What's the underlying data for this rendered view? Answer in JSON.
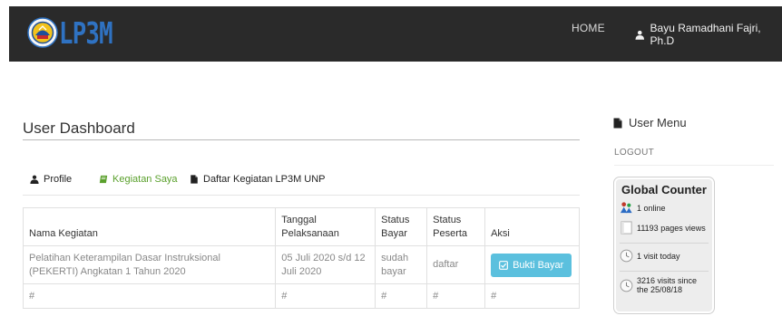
{
  "header": {
    "logo_text": "LP3M",
    "nav_home": "HOME",
    "user_name": "Bayu Ramadhani Fajri, Ph.D"
  },
  "main": {
    "title": "User Dashboard",
    "tabs": [
      {
        "label": "Profile",
        "icon": "user-icon",
        "active": false
      },
      {
        "label": "Kegiatan Saya",
        "icon": "book-icon",
        "active": true
      },
      {
        "label": "Daftar Kegiatan LP3M UNP",
        "icon": "file-icon",
        "active": false
      }
    ],
    "table": {
      "headers": [
        "Nama Kegiatan",
        "Tanggal Pelaksanaan",
        "Status Bayar",
        "Status Peserta",
        "Aksi"
      ],
      "rows": [
        {
          "nama": "Pelatihan Keterampilan Dasar Instruksional (PEKERTI) Angkatan 1 Tahun 2020",
          "tanggal": "05 Juli 2020 s/d 12 Juli 2020",
          "status_bayar": "sudah bayar",
          "status_peserta": "daftar",
          "aksi": "Bukti Bayar"
        },
        {
          "nama": "#",
          "tanggal": "#",
          "status_bayar": "#",
          "status_peserta": "#",
          "aksi": "#"
        }
      ]
    }
  },
  "sidebar": {
    "heading": "User Menu",
    "logout": "LOGOUT",
    "counter": {
      "title": "Global Counter",
      "online": "1 online",
      "page_views": "11193 pages views",
      "visits_today": "1 visit today",
      "visits_since": "3216 visits since the 25/08/18"
    }
  },
  "colors": {
    "navbar_bg": "#2a2a2a",
    "logo_blue": "#2f72c2",
    "active_tab": "#5aa02c",
    "button_info": "#5bc0de"
  }
}
